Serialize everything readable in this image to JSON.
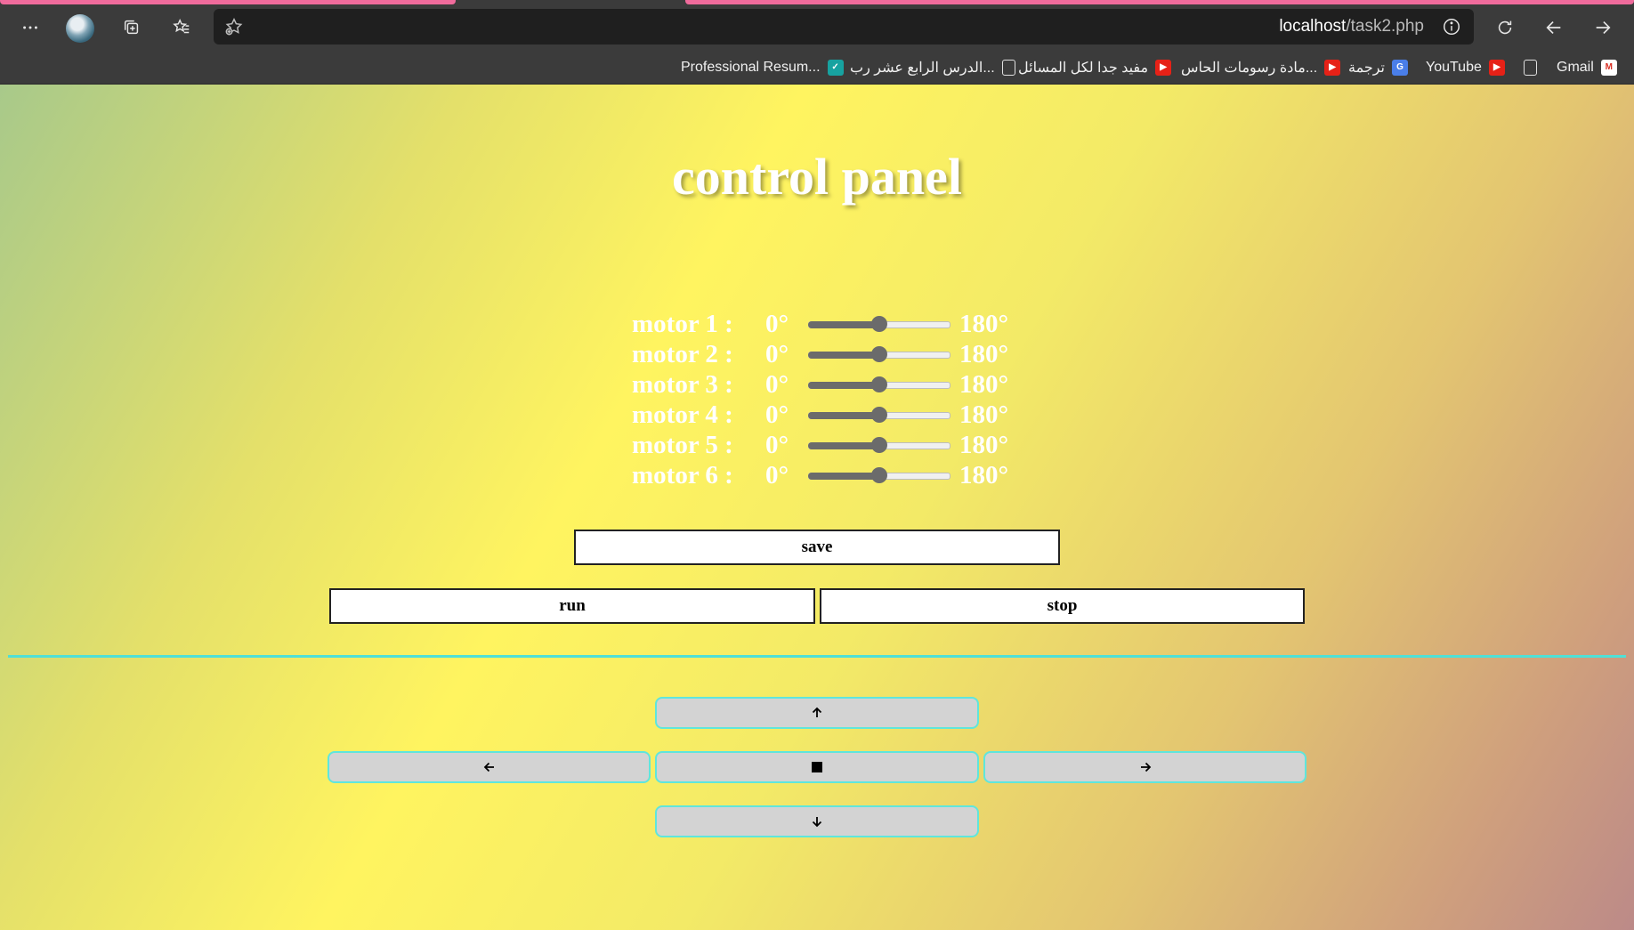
{
  "browser": {
    "url_host": "localhost",
    "url_path": "/task2.php",
    "bookmarks": [
      {
        "label": "Gmail",
        "icon": "gmail-icon"
      },
      {
        "label": "",
        "icon": "document-icon"
      },
      {
        "label": "YouTube",
        "icon": "youtube-icon"
      },
      {
        "label": "ترجمة",
        "icon": "google-translate-icon"
      },
      {
        "label": "مادة رسومات الحاس...",
        "icon": "youtube-icon"
      },
      {
        "label": "مفيد جدا لكل المسائل",
        "icon": "youtube-icon"
      },
      {
        "label": "الدرس الرابع عشر رب...",
        "icon": "document-icon"
      },
      {
        "label": "Professional Resum...",
        "icon": "resume-icon"
      }
    ]
  },
  "page": {
    "title": "control panel",
    "motors": [
      {
        "label": "motor 1 :",
        "min": "0°",
        "max": "180°",
        "value": 90
      },
      {
        "label": "motor 2 :",
        "min": "0°",
        "max": "180°",
        "value": 90
      },
      {
        "label": "motor 3 :",
        "min": "0°",
        "max": "180°",
        "value": 90
      },
      {
        "label": "motor 4 :",
        "min": "0°",
        "max": "180°",
        "value": 90
      },
      {
        "label": "motor 5 :",
        "min": "0°",
        "max": "180°",
        "value": 90
      },
      {
        "label": "motor 6 :",
        "min": "0°",
        "max": "180°",
        "value": 90
      }
    ],
    "save_label": "save",
    "run_label": "run",
    "stop_label": "stop",
    "direction_buttons": {
      "up": "arrow-up-icon",
      "left": "arrow-left-icon",
      "stop": "stop-square-icon",
      "right": "arrow-right-icon",
      "down": "arrow-down-icon"
    }
  },
  "colors": {
    "accent_line": "#4fe0d6",
    "title_text": "#ffffff",
    "slider_fill": "#6b6b6b"
  }
}
